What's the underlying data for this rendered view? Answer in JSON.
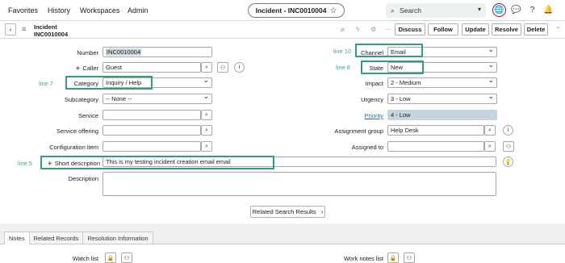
{
  "nav": {
    "favorites": "Favorites",
    "history": "History",
    "workspaces": "Workspaces",
    "admin": "Admin",
    "record_title": "Incident - INC0010004",
    "search_placeholder": "Search"
  },
  "header": {
    "table": "Incident",
    "number": "INC0010004",
    "buttons": [
      "Discuss",
      "Follow",
      "Update",
      "Resolve",
      "Delete"
    ]
  },
  "fields": {
    "number_label": "Number",
    "number_value": "INC0010004",
    "caller_label": "Caller",
    "caller_value": "Guest",
    "category_label": "Category",
    "category_value": "Inquiry / Help",
    "subcategory_label": "Subcategory",
    "subcategory_value": "-- None --",
    "service_label": "Service",
    "service_offering_label": "Service offering",
    "configuration_item_label": "Configuration item",
    "short_description_label": "Short description",
    "short_description_value": "This is my testing incident creation email email",
    "description_label": "Description",
    "channel_label": "Channel",
    "channel_value": "Email",
    "state_label": "State",
    "state_value": "New",
    "impact_label": "Impact",
    "impact_value": "2 - Medium",
    "urgency_label": "Urgency",
    "urgency_value": "3 - Low",
    "priority_label": "Priority",
    "priority_value": "4 - Low",
    "assignment_group_label": "Assignment group",
    "assignment_group_value": "Help Desk",
    "assigned_to_label": "Assigned to"
  },
  "annotations": {
    "line10": "line 10",
    "line8": "line 8",
    "line7": "line 7",
    "line5": "line 5"
  },
  "related_search": "Related Search Results",
  "tabs": [
    "Notes",
    "Related Records",
    "Resolution Information"
  ],
  "notes": {
    "watch_list_label": "Watch list",
    "work_notes_list_label": "Work notes list"
  },
  "colors": {
    "annotation": "#2d9d84",
    "priority_bg": "#c6d4dd",
    "globe_ring": "#b5121b"
  }
}
